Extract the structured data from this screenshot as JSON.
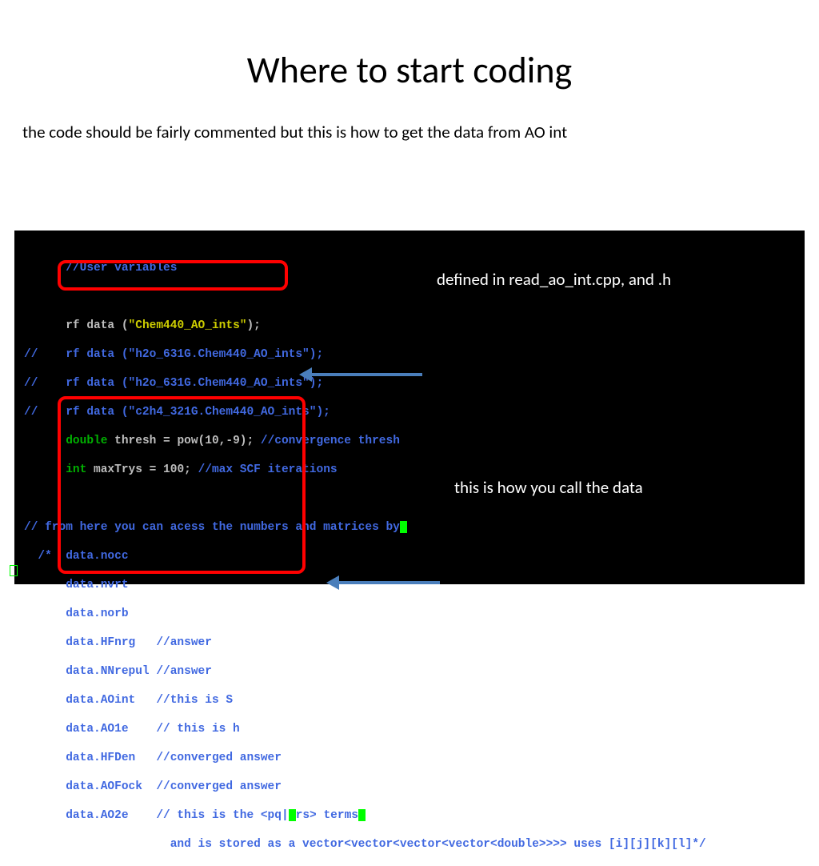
{
  "title": "Where to start coding",
  "subtitle": "the code should be fairly commented but this is how to get the data from AO int",
  "annotations": {
    "a1": "defined in read_ao_int.cpp, and .h",
    "a2": "this is how you call the data"
  },
  "code": {
    "l1": "//User variables",
    "l2a": "rf data (",
    "l2b": "\"Chem440_AO_ints\"",
    "l2c": ");",
    "l3": "//    rf data (\"h2o_631G.Chem440_AO_ints\");",
    "l4": "//    rf data (\"h2o_631G.Chem440_AO_ints\");",
    "l5": "//    rf data (\"c2h4_321G.Chem440_AO_ints\");",
    "l6a": "double",
    "l6b": " thresh = pow(10,-9); ",
    "l6c": "//convergence thresh",
    "l7a": "int",
    "l7b": " maxTrys = 100; ",
    "l7c": "//max SCF iterations",
    "l8": "// from here you can acess the numbers and matrices by",
    "l9": "  /*  data.nocc",
    "l10": "      data.nvrt",
    "l11": "      data.norb",
    "l12": "      data.HFnrg   //answer",
    "l13": "      data.NNrepul //answer",
    "l14": "      data.AOint   //this is S",
    "l15": "      data.AO1e    // this is h",
    "l16": "      data.HFDen   //converged answer",
    "l17": "      data.AOFock  //converged answer",
    "l18a": "      data.AO2e    // this is the <pq|",
    "l18b": "rs> terms",
    "l19": "                     and is stored as a vector<vector<vector<vector<double>>>> uses [i][j][k][l]*/"
  }
}
